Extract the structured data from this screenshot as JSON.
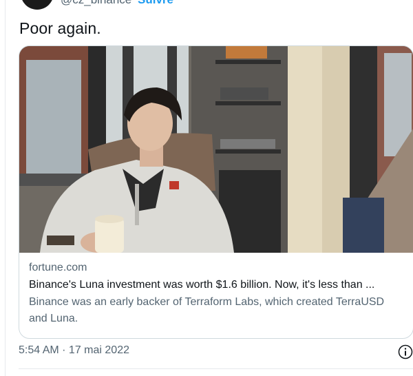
{
  "author": {
    "handle": "@cz_binance",
    "follow_label": "Suivre"
  },
  "tweet": {
    "text": "Poor again.",
    "timestamp": "5:54 AM · 17 mai 2022"
  },
  "card": {
    "domain": "fortune.com",
    "headline": "Binance's Luna investment was worth $1.6 billion. Now, it's less than ...",
    "description": "Binance was an early backer of Terraform Labs, which created TerraUSD and Luna.",
    "image_subject": "man-in-fleece-jacket-holding-cup"
  },
  "icons": {
    "info": "info-circle-icon"
  },
  "colors": {
    "accent": "#1d9bf0",
    "secondary_text": "#536471",
    "border": "#cfd9de"
  }
}
